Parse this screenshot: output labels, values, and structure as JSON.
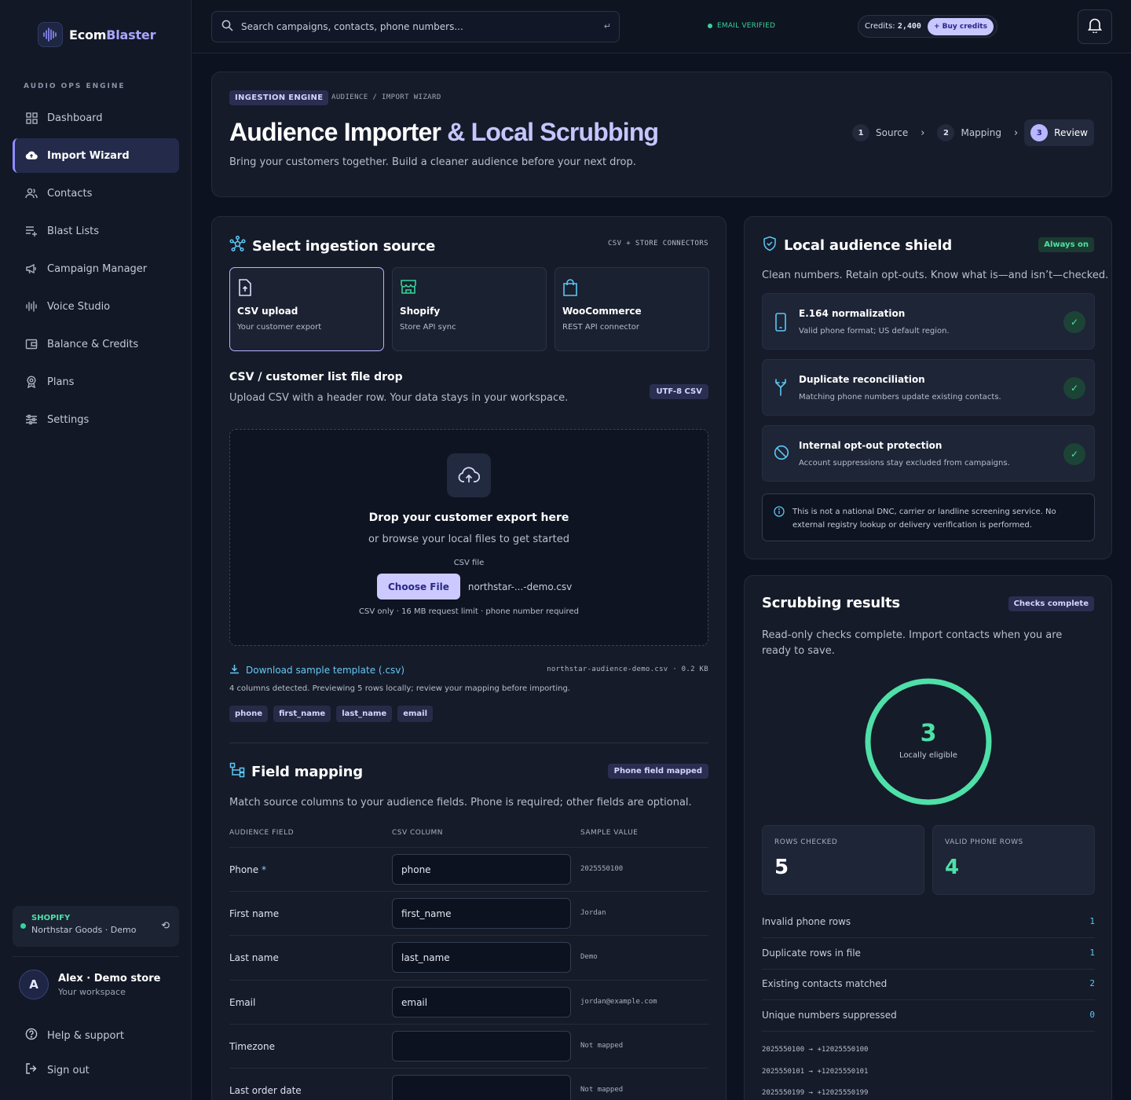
{
  "brand": {
    "name_a": "Ecom",
    "name_b": "Blaster"
  },
  "sidebar": {
    "heading": "AUDIO OPS ENGINE",
    "items": [
      {
        "label": "Dashboard",
        "icon": "grid-icon"
      },
      {
        "label": "Import Wizard",
        "icon": "cloud-upload-icon",
        "active": true
      },
      {
        "label": "Contacts",
        "icon": "users-icon"
      },
      {
        "label": "Blast Lists",
        "icon": "list-plus-icon"
      },
      {
        "label": "Campaign Manager",
        "icon": "megaphone-icon"
      },
      {
        "label": "Voice Studio",
        "icon": "audio-wave-icon"
      },
      {
        "label": "Balance & Credits",
        "icon": "wallet-icon"
      },
      {
        "label": "Plans",
        "icon": "badge-icon"
      },
      {
        "label": "Settings",
        "icon": "sliders-icon"
      }
    ],
    "store": {
      "platform": "SHOPIFY",
      "name": "Northstar Goods · Demo"
    },
    "user": {
      "initial": "A",
      "name": "Alex · Demo store",
      "sub": "Your workspace"
    },
    "help": "Help & support",
    "signout": "Sign out"
  },
  "topbar": {
    "search_placeholder": "Search campaigns, contacts, phone numbers...",
    "return_glyph": "↵",
    "email_status": "EMAIL VERIFIED",
    "credits_label": "Credits:",
    "credits_value": "2,400",
    "buy_label": "+ Buy credits"
  },
  "header": {
    "chip": "INGESTION ENGINE",
    "crumb": "AUDIENCE / IMPORT WIZARD",
    "title_a": "Audience Importer",
    "title_b": "& Local Scrubbing",
    "subtitle": "Bring your customers together. Build a cleaner audience before your next drop.",
    "steps": [
      {
        "n": "1",
        "label": "Source"
      },
      {
        "n": "2",
        "label": "Mapping"
      },
      {
        "n": "3",
        "label": "Review",
        "active": true
      }
    ]
  },
  "source": {
    "title": "Select ingestion source",
    "meta": "CSV + STORE CONNECTORS",
    "cards": [
      {
        "title": "CSV upload",
        "sub": "Your customer export",
        "selected": true
      },
      {
        "title": "Shopify",
        "sub": "Store API sync"
      },
      {
        "title": "WooCommerce",
        "sub": "REST API connector"
      }
    ],
    "drop_title": "CSV / customer list file drop",
    "drop_sub": "Upload CSV with a header row. Your data stays in your workspace.",
    "drop_chip": "UTF-8 CSV",
    "zone_title": "Drop your customer export here",
    "zone_sub": "or browse your local files to get started",
    "file_label": "CSV file",
    "choose_label": "Choose File",
    "file_name": "northstar-...-demo.csv",
    "hint": "CSV only · 16 MB request limit · phone number required",
    "download": "Download sample template (.csv)",
    "file_meta": "northstar-audience-demo.csv · 0.2 KB",
    "columns_note": "4 columns detected. Previewing 5 rows locally; review your mapping before importing.",
    "tags": [
      "phone",
      "first_name",
      "last_name",
      "email"
    ]
  },
  "mapping": {
    "title": "Field mapping",
    "chip": "Phone field mapped",
    "desc": "Match source columns to your audience fields. Phone is required; other fields are optional.",
    "headers": [
      "AUDIENCE FIELD",
      "CSV COLUMN",
      "SAMPLE VALUE"
    ],
    "rows": [
      {
        "field": "Phone",
        "required": "*",
        "column": "phone",
        "sample": "2025550100"
      },
      {
        "field": "First name",
        "column": "first_name",
        "sample": "Jordan"
      },
      {
        "field": "Last name",
        "column": "last_name",
        "sample": "Demo"
      },
      {
        "field": "Email",
        "column": "email",
        "sample": "jordan@example.com"
      },
      {
        "field": "Timezone",
        "column": "",
        "sample": "Not mapped"
      },
      {
        "field": "Last order date",
        "column": "",
        "sample": "Not mapped"
      }
    ]
  },
  "shield": {
    "title": "Local audience shield",
    "badge": "Always on",
    "desc": "Clean numbers. Retain opt-outs. Know what is—and isn’t—checked.",
    "checks": [
      {
        "title": "E.164 normalization",
        "sub": "Valid phone format; US default region.",
        "icon": "phone-icon"
      },
      {
        "title": "Duplicate reconciliation",
        "sub": "Matching phone numbers update existing contacts.",
        "icon": "merge-icon"
      },
      {
        "title": "Internal opt-out protection",
        "sub": "Account suppressions stay excluded from campaigns.",
        "icon": "ban-icon"
      }
    ],
    "check_mark": "✓",
    "note": "This is not a national DNC, carrier or landline screening service. No external registry lookup or delivery verification is performed."
  },
  "results": {
    "title": "Scrubbing results",
    "badge": "Checks complete",
    "desc": "Read-only checks complete. Import contacts when you are ready to save.",
    "eligible": "3",
    "eligible_label": "Locally eligible",
    "eligible_fraction": 0.6,
    "stats": [
      {
        "label": "ROWS CHECKED",
        "value": "5"
      },
      {
        "label": "VALID PHONE ROWS",
        "value": "4"
      }
    ],
    "rows": [
      {
        "label": "Invalid phone rows",
        "value": "1"
      },
      {
        "label": "Duplicate rows in file",
        "value": "1"
      },
      {
        "label": "Existing contacts matched",
        "value": "2"
      },
      {
        "label": "Unique numbers suppressed",
        "value": "0"
      }
    ],
    "normalized": [
      "2025550100 → +12025550100",
      "2025550101 → +12025550101",
      "2025550199 → +12025550199"
    ]
  },
  "colors": {
    "accent": "#8f8cff",
    "success": "#37d39a",
    "info": "#5cc8f5",
    "bg": "#0d1220"
  }
}
